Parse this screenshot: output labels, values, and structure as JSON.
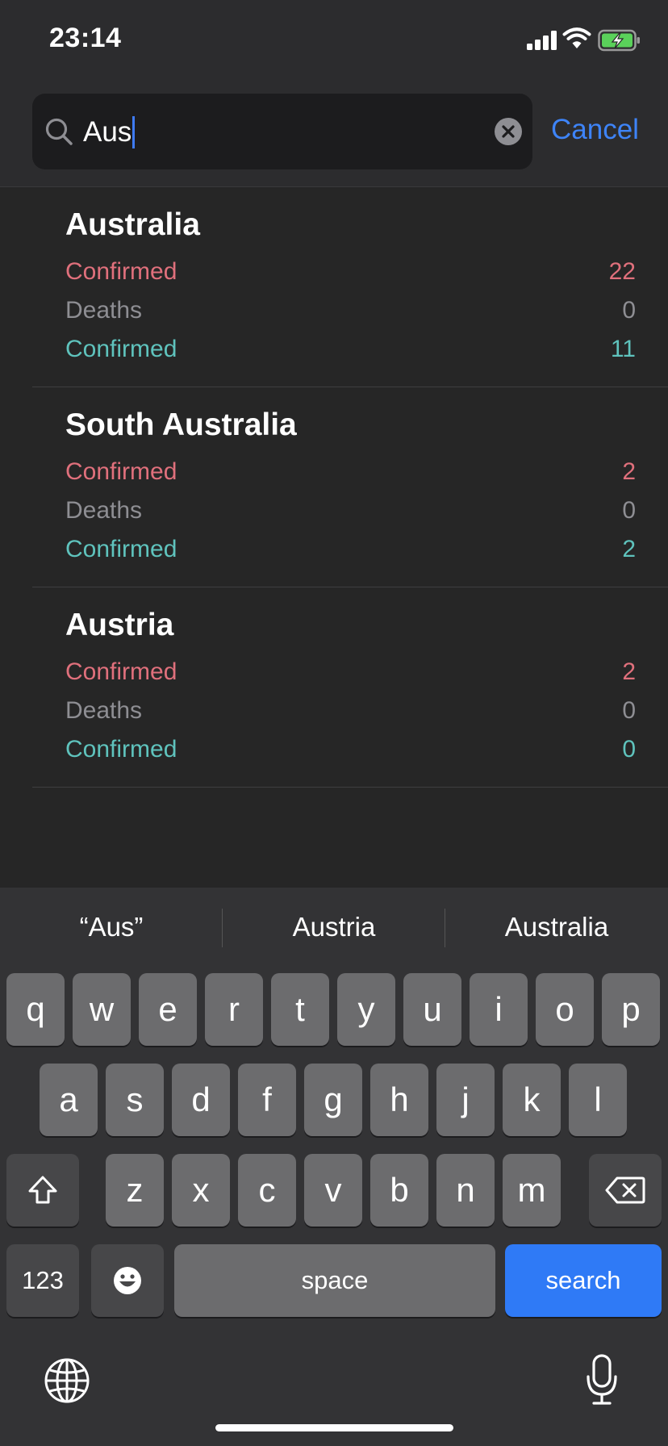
{
  "status_bar": {
    "time": "23:14"
  },
  "search": {
    "query": "Aus",
    "cancel_label": "Cancel"
  },
  "results": [
    {
      "title": "Australia",
      "rows": [
        {
          "label": "Confirmed",
          "value": "22"
        },
        {
          "label": "Deaths",
          "value": "0"
        },
        {
          "label": "Confirmed",
          "value": "11"
        }
      ]
    },
    {
      "title": "South Australia",
      "rows": [
        {
          "label": "Confirmed",
          "value": "2"
        },
        {
          "label": "Deaths",
          "value": "0"
        },
        {
          "label": "Confirmed",
          "value": "2"
        }
      ]
    },
    {
      "title": "Austria",
      "rows": [
        {
          "label": "Confirmed",
          "value": "2"
        },
        {
          "label": "Deaths",
          "value": "0"
        },
        {
          "label": "Confirmed",
          "value": "0"
        }
      ]
    }
  ],
  "colors": {
    "confirmed": "#e0707c",
    "deaths": "#8e8e93",
    "recovered": "#5fc3bd",
    "accent": "#3e84f8"
  },
  "keyboard": {
    "suggestions": [
      "“Aus”",
      "Austria",
      "Australia"
    ],
    "row1": [
      "q",
      "w",
      "e",
      "r",
      "t",
      "y",
      "u",
      "i",
      "o",
      "p"
    ],
    "row2": [
      "a",
      "s",
      "d",
      "f",
      "g",
      "h",
      "j",
      "k",
      "l"
    ],
    "row3": [
      "z",
      "x",
      "c",
      "v",
      "b",
      "n",
      "m"
    ],
    "numbers_label": "123",
    "space_label": "space",
    "search_label": "search",
    "icons": [
      "shift-icon",
      "backspace-icon",
      "emoji-icon",
      "globe-icon",
      "microphone-icon"
    ]
  }
}
